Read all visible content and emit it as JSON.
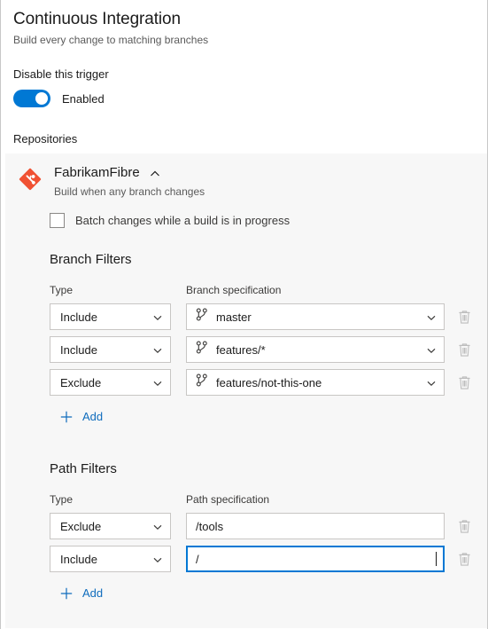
{
  "header": {
    "title": "Continuous Integration",
    "subtitle": "Build every change to matching branches"
  },
  "trigger": {
    "label": "Disable this trigger",
    "toggle_state_label": "Enabled",
    "toggle_on": true,
    "accent_color": "#0078d4"
  },
  "repositories": {
    "section_label": "Repositories",
    "repo": {
      "name": "FabrikamFibre",
      "description": "Build when any branch changes",
      "icon": "git-repo-icon",
      "collapse_icon": "chevron-up-icon",
      "icon_color": "#f05133"
    },
    "batch_checkbox": {
      "label": "Batch changes while a build is in progress",
      "checked": false
    }
  },
  "branch_filters": {
    "title": "Branch Filters",
    "col_type": "Type",
    "col_spec": "Branch specification",
    "rows": [
      {
        "type": "Include",
        "spec": "master",
        "spec_icon": "git-branch-icon",
        "delete_icon": "trash-icon",
        "focused": false
      },
      {
        "type": "Include",
        "spec": "features/*",
        "spec_icon": "git-branch-icon",
        "delete_icon": "trash-icon",
        "focused": false
      },
      {
        "type": "Exclude",
        "spec": "features/not-this-one",
        "spec_icon": "git-branch-icon",
        "delete_icon": "trash-icon",
        "focused": false
      }
    ],
    "add_label": "Add",
    "add_icon": "plus-icon"
  },
  "path_filters": {
    "title": "Path Filters",
    "col_type": "Type",
    "col_spec": "Path specification",
    "rows": [
      {
        "type": "Exclude",
        "spec": "/tools",
        "delete_icon": "trash-icon",
        "focused": false
      },
      {
        "type": "Include",
        "spec": "/",
        "delete_icon": "trash-icon",
        "focused": true
      }
    ],
    "add_label": "Add",
    "add_icon": "plus-icon"
  },
  "dropdown_options": [
    "Include",
    "Exclude"
  ],
  "colors": {
    "accent": "#0078d4",
    "link": "#0f6cbd",
    "card_bg": "#f7f7f7",
    "border": "#c8c6c4"
  }
}
